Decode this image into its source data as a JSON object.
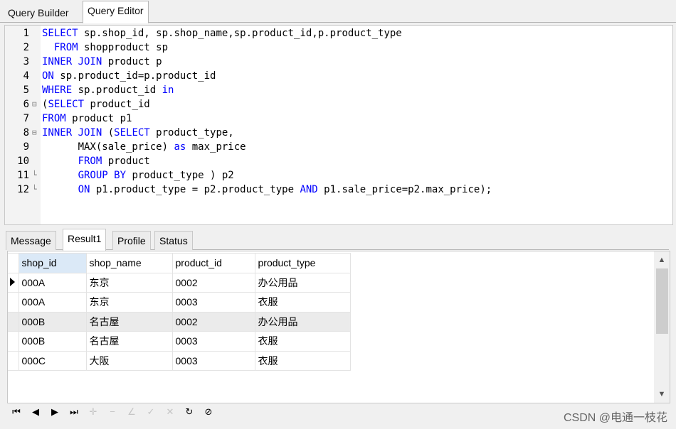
{
  "top_tabs": [
    {
      "label": "Query Builder",
      "active": false
    },
    {
      "label": "Query Editor",
      "active": true
    }
  ],
  "editor": {
    "lines": [
      {
        "n": "1",
        "fold": "",
        "parts": [
          {
            "t": "SELECT",
            "k": true
          },
          {
            "t": " sp.shop_id, sp.shop_name,sp.product_id,p.product_type",
            "k": false
          }
        ]
      },
      {
        "n": "2",
        "fold": "",
        "parts": [
          {
            "t": "  ",
            "k": false
          },
          {
            "t": "FROM",
            "k": true
          },
          {
            "t": " shopproduct sp",
            "k": false
          }
        ]
      },
      {
        "n": "3",
        "fold": "",
        "parts": [
          {
            "t": "INNER JOIN",
            "k": true
          },
          {
            "t": " product p",
            "k": false
          }
        ]
      },
      {
        "n": "4",
        "fold": "",
        "parts": [
          {
            "t": "ON",
            "k": true
          },
          {
            "t": " sp.product_id=p.product_id",
            "k": false
          }
        ]
      },
      {
        "n": "5",
        "fold": "",
        "parts": [
          {
            "t": "WHERE",
            "k": true
          },
          {
            "t": " sp.product_id ",
            "k": false
          },
          {
            "t": "in",
            "k": true
          }
        ]
      },
      {
        "n": "6",
        "fold": "⊟",
        "parts": [
          {
            "t": "(",
            "k": false
          },
          {
            "t": "SELECT",
            "k": true
          },
          {
            "t": " product_id",
            "k": false
          }
        ]
      },
      {
        "n": "7",
        "fold": "",
        "parts": [
          {
            "t": "FROM",
            "k": true
          },
          {
            "t": " product p1",
            "k": false
          }
        ]
      },
      {
        "n": "8",
        "fold": "⊟",
        "parts": [
          {
            "t": "INNER JOIN",
            "k": true
          },
          {
            "t": " (",
            "k": false
          },
          {
            "t": "SELECT",
            "k": true
          },
          {
            "t": " product_type,",
            "k": false
          }
        ]
      },
      {
        "n": "9",
        "fold": "",
        "parts": [
          {
            "t": "      MAX(sale_price) ",
            "k": false
          },
          {
            "t": "as",
            "k": true
          },
          {
            "t": " max_price",
            "k": false
          }
        ]
      },
      {
        "n": "10",
        "fold": "",
        "parts": [
          {
            "t": "      ",
            "k": false
          },
          {
            "t": "FROM",
            "k": true
          },
          {
            "t": " product",
            "k": false
          }
        ]
      },
      {
        "n": "11",
        "fold": "└",
        "parts": [
          {
            "t": "      ",
            "k": false
          },
          {
            "t": "GROUP BY",
            "k": true
          },
          {
            "t": " product_type ) p2",
            "k": false
          }
        ]
      },
      {
        "n": "12",
        "fold": "└",
        "parts": [
          {
            "t": "      ",
            "k": false
          },
          {
            "t": "ON",
            "k": true
          },
          {
            "t": " p1.product_type = p2.product_type ",
            "k": false
          },
          {
            "t": "AND",
            "k": true
          },
          {
            "t": " p1.sale_price=p2.max_price);",
            "k": false
          }
        ]
      }
    ]
  },
  "result_tabs": [
    {
      "label": "Message",
      "active": false
    },
    {
      "label": "Result1",
      "active": true
    },
    {
      "label": "Profile",
      "active": false
    },
    {
      "label": "Status",
      "active": false
    }
  ],
  "grid": {
    "columns": [
      "shop_id",
      "shop_name",
      "product_id",
      "product_type"
    ],
    "rows": [
      [
        "000A",
        "东京",
        "0002",
        "办公用品"
      ],
      [
        "000A",
        "东京",
        "0003",
        "衣服"
      ],
      [
        "000B",
        "名古屋",
        "0002",
        "办公用品"
      ],
      [
        "000B",
        "名古屋",
        "0003",
        "衣服"
      ],
      [
        "000C",
        "大阪",
        "0003",
        "衣服"
      ]
    ],
    "current_row": 0
  },
  "navbar": {
    "buttons": [
      {
        "name": "first-record-button",
        "glyph": "⏮",
        "enabled": true
      },
      {
        "name": "prior-record-button",
        "glyph": "◀",
        "enabled": true
      },
      {
        "name": "next-record-button",
        "glyph": "▶",
        "enabled": true
      },
      {
        "name": "last-record-button",
        "glyph": "⏭",
        "enabled": true
      },
      {
        "name": "insert-record-button",
        "glyph": "✛",
        "enabled": false
      },
      {
        "name": "delete-record-button",
        "glyph": "−",
        "enabled": false
      },
      {
        "name": "edit-record-button",
        "glyph": "∠",
        "enabled": false
      },
      {
        "name": "post-edit-button",
        "glyph": "✓",
        "enabled": false
      },
      {
        "name": "cancel-edit-button",
        "glyph": "✕",
        "enabled": false
      },
      {
        "name": "refresh-button",
        "glyph": "↻",
        "enabled": true
      },
      {
        "name": "stop-button",
        "glyph": "⊘",
        "enabled": true
      }
    ]
  },
  "watermark": "CSDN @电通一枝花"
}
